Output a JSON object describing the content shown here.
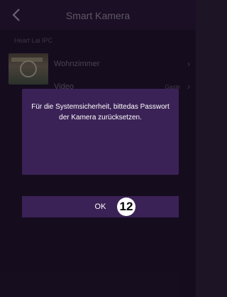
{
  "header": {
    "title": "Smart Kamera"
  },
  "section": {
    "label": "Heart Lai IPC"
  },
  "rows": [
    {
      "label": "Wohnzimmer"
    },
    {
      "label": "Video",
      "value": "Gaste"
    }
  ],
  "dialog": {
    "message": "Für die Systemsicherheit, bittedas Passwort der Kamera zurücksetzen.",
    "ok_label": "OK"
  },
  "callout": {
    "number": "12"
  },
  "colors": {
    "dialog_bg": "#3b2256",
    "screen_bg": "#1c1226"
  }
}
